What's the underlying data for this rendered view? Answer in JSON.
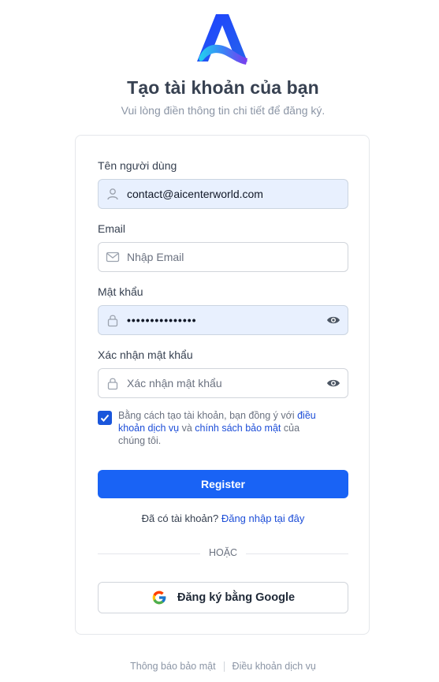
{
  "header": {
    "title": "Tạo tài khoản của bạn",
    "subtitle": "Vui lòng điền thông tin chi tiết để đăng ký."
  },
  "form": {
    "username_label": "Tên người dùng",
    "username_value": "contact@aicenterworld.com",
    "email_label": "Email",
    "email_placeholder": "Nhập Email",
    "password_label": "Mật khẩu",
    "password_value": "•••••••••••••••",
    "confirm_label": "Xác nhận mật khẩu",
    "confirm_placeholder": "Xác nhận mật khẩu",
    "terms_checked": true,
    "terms_prefix": "Bằng cách tạo tài khoản, bạn đồng ý với ",
    "terms_link1": "điều khoản dịch vụ",
    "terms_mid": " và ",
    "terms_link2": "chính sách bảo mật",
    "terms_suffix": " của chúng tôi.",
    "register_label": "Register",
    "login_prompt": "Đã có tài khoản? ",
    "login_link": "Đăng nhập tại đây",
    "divider": "HOẶC",
    "google_label": "Đăng ký bằng Google"
  },
  "footer": {
    "privacy": "Thông báo bảo mật",
    "terms": "Điều khoản dịch vụ"
  },
  "colors": {
    "primary": "#1963f5",
    "link": "#1d4ed8",
    "autofill": "#e8f0fe"
  },
  "icons": [
    "logo-icon",
    "user-icon",
    "mail-icon",
    "lock-icon",
    "eye-icon",
    "check-icon",
    "google-icon"
  ]
}
